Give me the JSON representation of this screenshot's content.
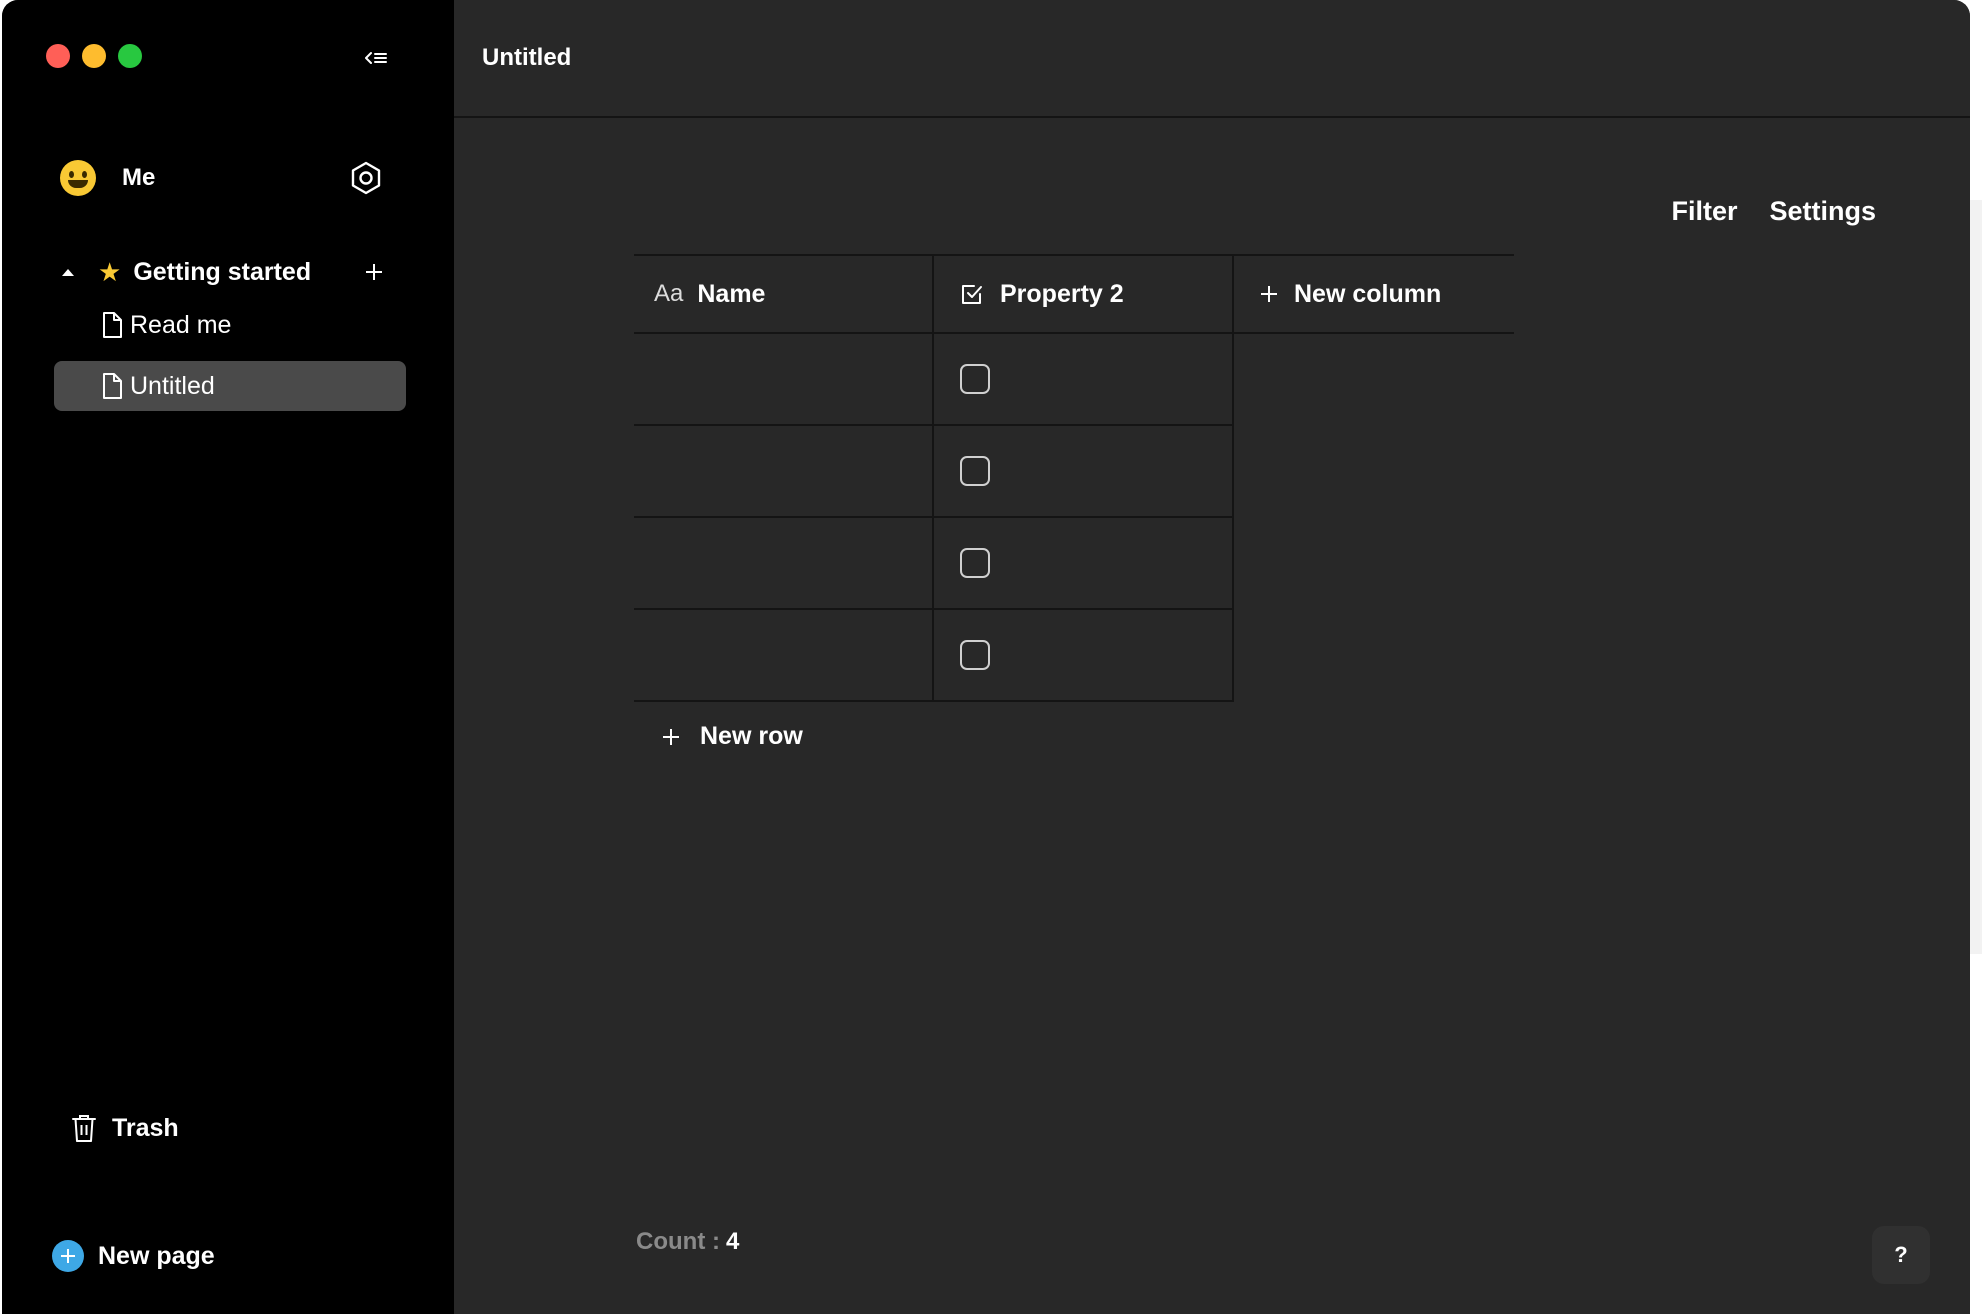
{
  "window": {
    "traffic_lights": {
      "red": "#ff5f57",
      "yellow": "#febc2e",
      "green": "#28c840"
    }
  },
  "sidebar": {
    "user": {
      "name": "Me",
      "avatar_icon": "grinning-face-emoji"
    },
    "groups": [
      {
        "label": "Getting started",
        "icon": "star-icon",
        "expanded": true,
        "pages": [
          {
            "label": "Read me",
            "active": false
          },
          {
            "label": "Untitled",
            "active": true
          }
        ]
      }
    ],
    "trash_label": "Trash",
    "new_page_label": "New page",
    "accent": "#3ea8e6"
  },
  "main": {
    "doc_title": "Untitled",
    "actions": {
      "filter": "Filter",
      "settings": "Settings"
    },
    "grid": {
      "columns": [
        {
          "label": "Name",
          "type_label": "Aa"
        },
        {
          "label": "Property 2",
          "type": "checkbox"
        },
        {
          "label": "New column"
        }
      ],
      "rows": [
        {
          "name": "",
          "property_2": false
        },
        {
          "name": "",
          "property_2": false
        },
        {
          "name": "",
          "property_2": false
        },
        {
          "name": "",
          "property_2": false
        }
      ],
      "new_row_label": "New row"
    },
    "footer": {
      "count_label": "Count :",
      "count_value": "4"
    },
    "help_label": "?"
  }
}
